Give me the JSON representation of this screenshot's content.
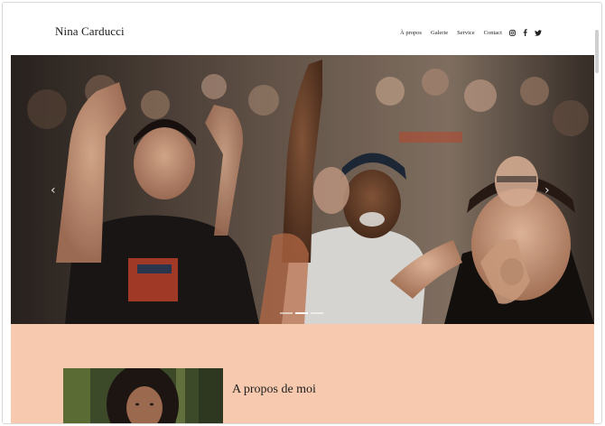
{
  "header": {
    "site_title": "Nina Carducci",
    "nav": [
      "À propos",
      "Galerie",
      "Service",
      "Contact"
    ],
    "social_icons": [
      "instagram-icon",
      "facebook-icon",
      "twitter-icon"
    ]
  },
  "hero": {
    "slides": 3,
    "active_slide": 1,
    "prev_icon": "chevron-left-icon",
    "next_icon": "chevron-right-icon"
  },
  "about": {
    "title": "A propos de moi"
  },
  "colors": {
    "about_bg": "#f7c9ae",
    "text": "#222222"
  }
}
